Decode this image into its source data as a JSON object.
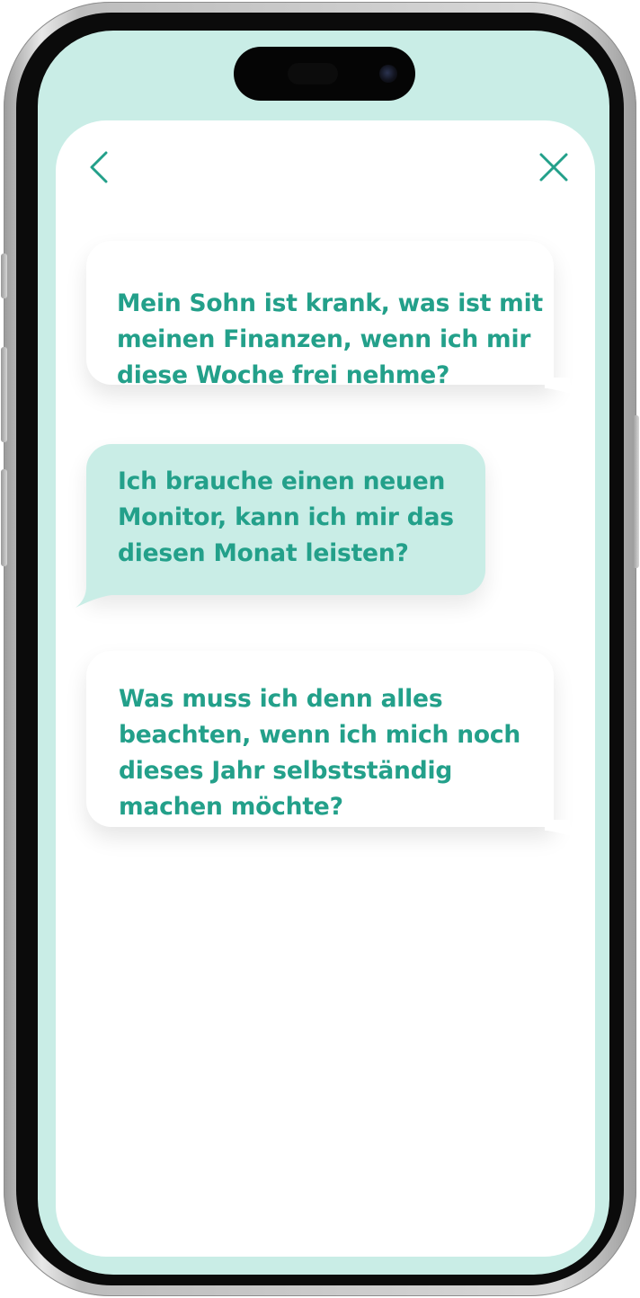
{
  "header": {
    "back_icon": "chevron-left-icon",
    "close_icon": "close-icon"
  },
  "colors": {
    "accent": "#23a08a",
    "mint": "#c9ede6",
    "sheet": "#ffffff"
  },
  "suggestions": [
    {
      "text": "Mein Sohn ist krank, was ist mit\nmeinen Finanzen, wenn ich mir\ndiese Woche frei nehme?"
    },
    {
      "text": "Ich brauche einen neuen\nMonitor, kann ich mir das\ndiesen Monat leisten?"
    },
    {
      "text": "Was muss ich denn alles\nbeachten, wenn ich mich noch\ndieses Jahr selbstständig\nmachen möchte?"
    }
  ]
}
